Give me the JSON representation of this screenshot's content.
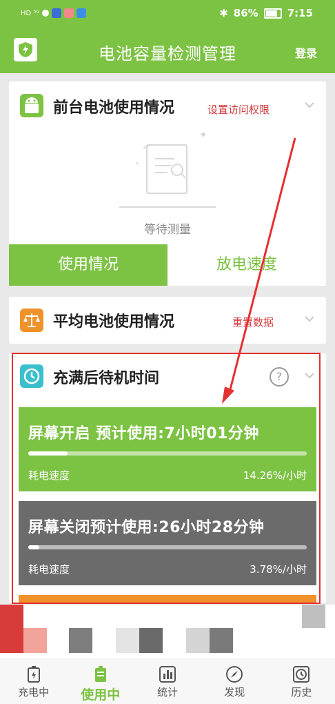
{
  "status_bar": {
    "left": "HD ⁵ᴳ",
    "battery_pct": "86%",
    "time": "7:15"
  },
  "app": {
    "title": "电池容量检测管理",
    "login": "登录"
  },
  "foreground": {
    "title": "前台电池使用情况",
    "link": "设置访问权限",
    "waiting": "等待测量",
    "tabs": [
      "使用情况",
      "放电速度"
    ],
    "active_tab": 0
  },
  "average": {
    "title": "平均电池使用情况",
    "link": "重置数据"
  },
  "standby": {
    "title": "充满后待机时间",
    "help": "?",
    "screen_on": {
      "title": "屏幕开启  预计使用:7小时01分钟",
      "rate_label": "耗电速度",
      "rate": "14.26%/小时",
      "progress": 0.14
    },
    "screen_off": {
      "title": "屏幕关闭预计使用:26小时28分钟",
      "rate_label": "耗电速度",
      "rate": "3.78%/小时",
      "progress": 0.04
    }
  },
  "colors": {
    "brand": "#7cc243",
    "screen_off": "#6b6b6b",
    "link_red": "#d33b3b",
    "highlight": "#e53030"
  },
  "nav": [
    {
      "label": "充电中",
      "icon": "battery-charging-icon"
    },
    {
      "label": "使用中",
      "icon": "battery-icon",
      "active": true
    },
    {
      "label": "统计",
      "icon": "bar-chart-icon"
    },
    {
      "label": "发现",
      "icon": "compass-icon"
    },
    {
      "label": "历史",
      "icon": "clock-icon"
    }
  ]
}
